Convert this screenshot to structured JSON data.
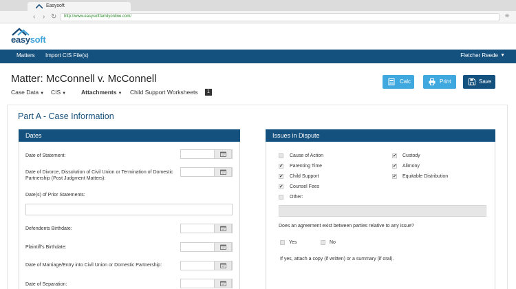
{
  "browser": {
    "tab_title": "Easysoft",
    "url": "http://www.easysoftfamilyonline.com/"
  },
  "app": {
    "logo_part1": "easy",
    "logo_part2": "soft"
  },
  "navbar": {
    "items": [
      "Matters",
      "Import CIS File(s)"
    ],
    "user": "Fletcher Reede"
  },
  "matter": {
    "title": "Matter: McConnell v. McConnell",
    "subnav": [
      "Case Data",
      "CIS",
      "Attachments",
      "Child Support Worksheets"
    ],
    "badge": "1"
  },
  "toolbar": {
    "calc_label": "Calc",
    "print_label": "Print",
    "save_label": "Save"
  },
  "part": {
    "title": "Part A - Case Information"
  },
  "dates": {
    "header": "Dates",
    "statement": "Date of Statement:",
    "divorce": "Date of Divorce, Dissolution of  Civil Union or Termination of Domestic Partnership (Post Judgment Matters):",
    "prior": "Date(s) of Prior Statements:",
    "defendant": "Defendents Birthdate:",
    "plaintiff": "Plaintiff's Birthdate:",
    "marriage": "Date of Marriage/Entry into Civil Union or Domestic Partnership:",
    "separation": "Date of Separation:"
  },
  "issues": {
    "header": "Issues in Dispute",
    "cause": "Cause of Action",
    "parenting": "Parenting Time",
    "child_support": "Child Support",
    "counsel": "Counsel Fees",
    "other": "Other:",
    "custody": "Custody",
    "alimony": "Alimony",
    "equitable": "Equitable Distribution",
    "question": "Does an agreement exist between parties relative to any issue?",
    "yes": "Yes",
    "no": "No",
    "note": "If yes, attach a copy (if written) or a summary (if oral)."
  },
  "colors": {
    "primary": "#15517e",
    "accent": "#3fa8de"
  }
}
